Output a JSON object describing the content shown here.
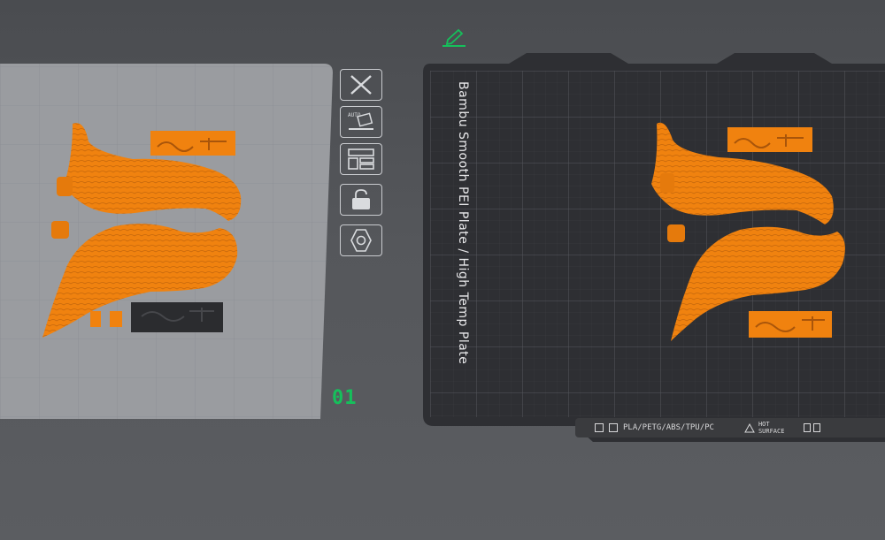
{
  "toolbar": {
    "icons": [
      "close-icon",
      "auto-orient-icon",
      "arrange-icon",
      "lock-icon",
      "settings-icon"
    ]
  },
  "plate": {
    "index_label": "01",
    "name": "Bambu Smooth PEI Plate / High Temp Plate",
    "materials": "PLA/PETG/ABS/TPU/PC",
    "hot_warning_line1": "HOT",
    "hot_warning_line2": "SURFACE"
  },
  "colors": {
    "filament": "#f0820f",
    "accent": "#15c05b",
    "plate_dark": "#2e2f33"
  }
}
